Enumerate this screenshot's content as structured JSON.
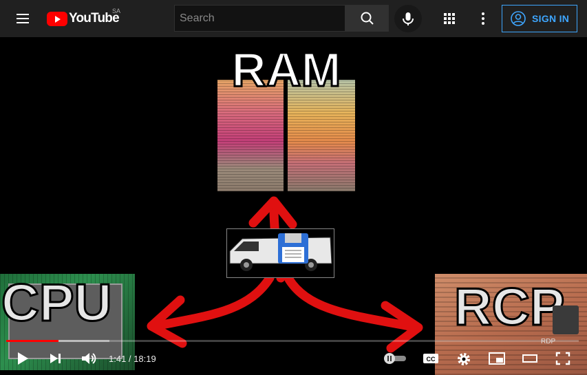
{
  "header": {
    "logo_text": "YouTube",
    "region": "SA",
    "search_placeholder": "Search",
    "signin_label": "SIGN IN",
    "icons": [
      "menu-icon",
      "search-icon",
      "mic-icon",
      "apps-icon",
      "more-vert-icon",
      "account-icon"
    ]
  },
  "video": {
    "frame_labels": {
      "ram": "RAM",
      "cpu": "CPU",
      "rcp": "RCP",
      "rdp": "RDP"
    },
    "progress_fraction": 0.0911,
    "buffered_fraction": 0.18
  },
  "controls": {
    "time_display": "1:41 / 18:19",
    "icons": [
      "play-icon",
      "next-icon",
      "volume-icon",
      "autoplay-toggle-icon",
      "captions-icon",
      "settings-icon",
      "miniplayer-icon",
      "theater-icon",
      "fullscreen-icon"
    ]
  },
  "colors": {
    "brand_red": "#ff0000",
    "link_blue": "#3ea6ff",
    "topbar": "#202020"
  }
}
